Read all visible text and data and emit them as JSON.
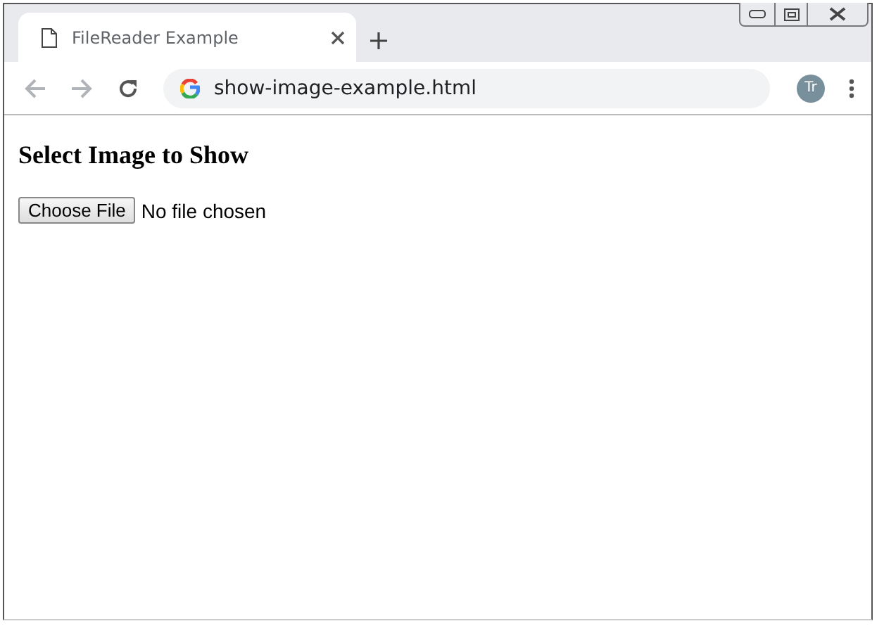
{
  "tab": {
    "title": "FileReader Example"
  },
  "address_bar": {
    "url": "show-image-example.html"
  },
  "profile": {
    "initials": "Tr"
  },
  "page": {
    "heading": "Select Image to Show",
    "file_button": "Choose File",
    "file_status": "No file chosen"
  }
}
